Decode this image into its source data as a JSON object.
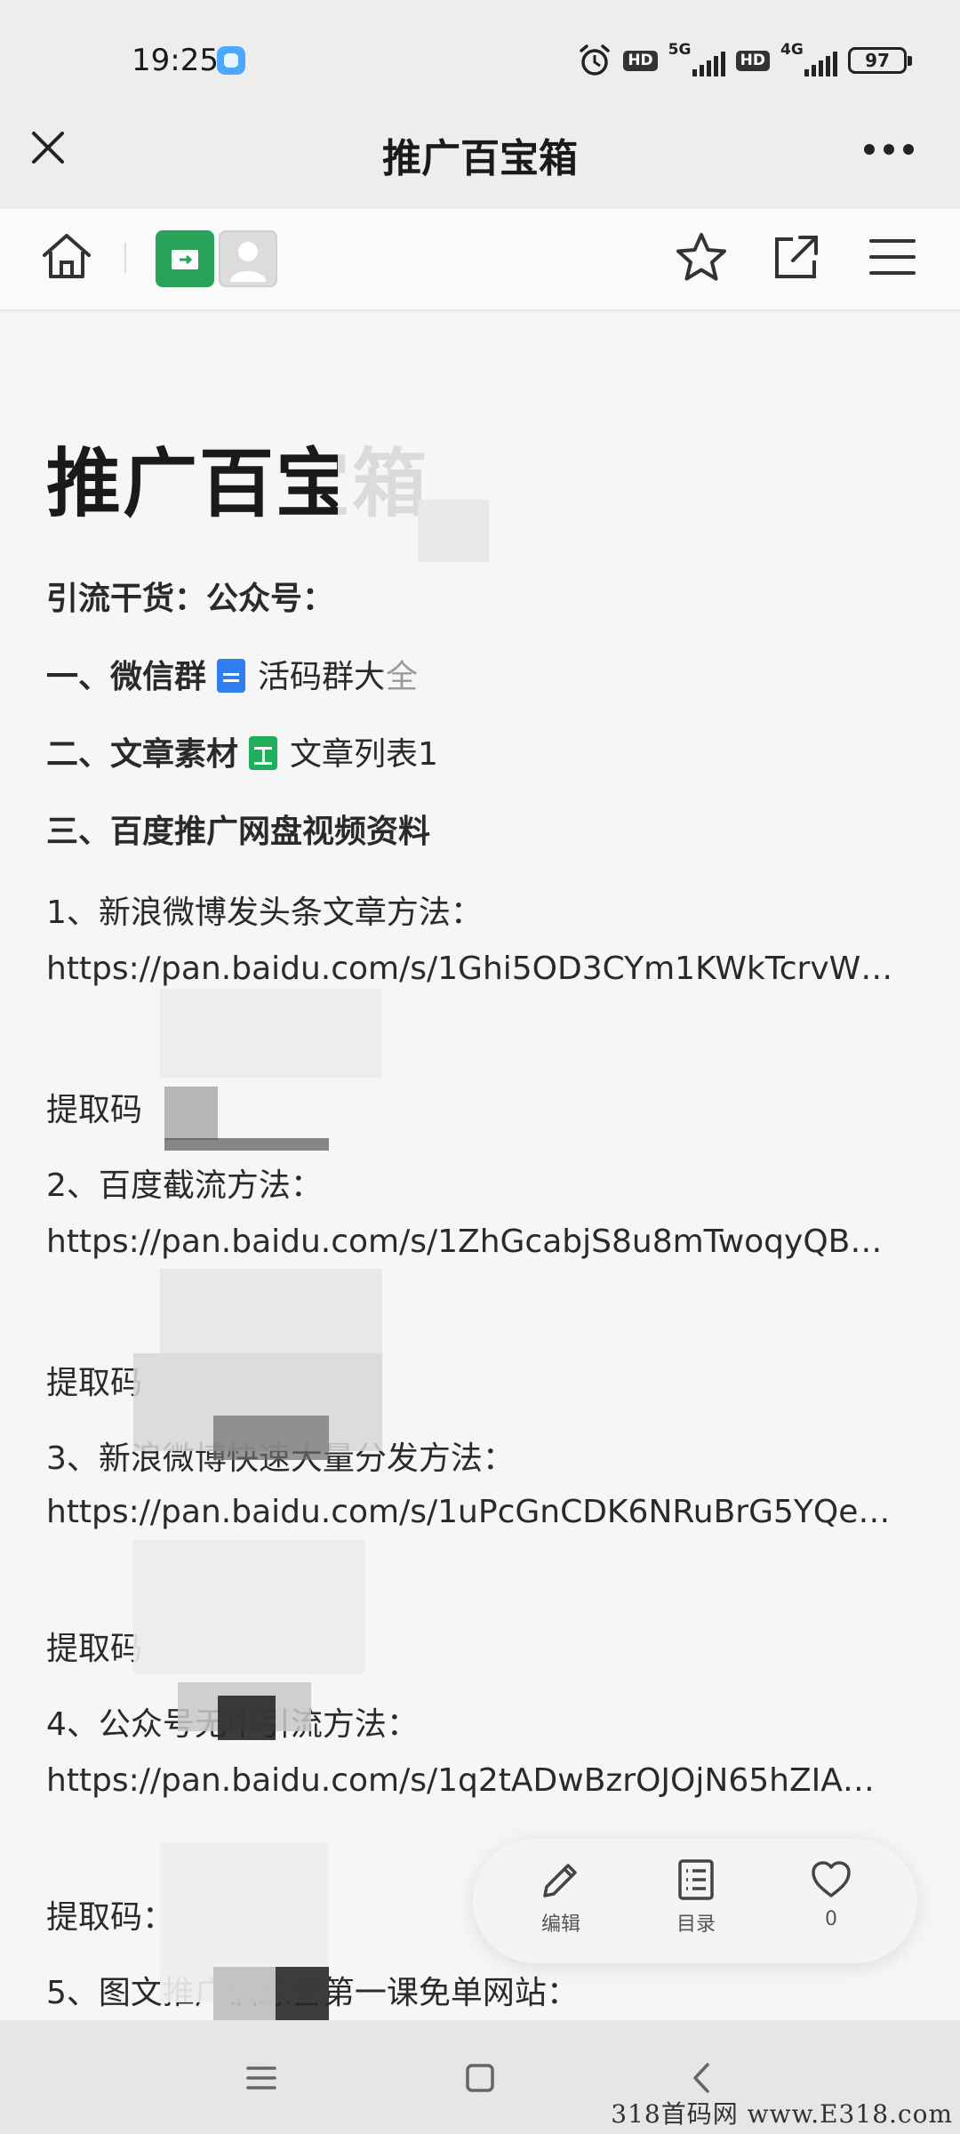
{
  "status_bar": {
    "time": "19:25",
    "hd_label": "HD",
    "net1": "5G",
    "net2": "4G",
    "battery": "97"
  },
  "title_bar": {
    "title": "推广百宝箱"
  },
  "document": {
    "title": "推广百宝箱",
    "lines": [
      {
        "text": "引流干货：公众号：",
        "bold": true
      },
      {
        "text": "一、微信群",
        "bold": true,
        "attachment_icon": "doc-blue-icon",
        "attachment_text": "活码群大全"
      },
      {
        "text": "二、文章素材",
        "bold": true,
        "attachment_icon": "sheet-green-icon",
        "attachment_text": "文章列表1"
      },
      {
        "text": "三、百度推广网盘视频资料",
        "bold": true
      },
      {
        "text": "1、新浪微博发头条文章方法："
      },
      {
        "text": "https://pan.baidu.com/s/1Ghi5OD3CYm1KWkTcrvW…"
      },
      {
        "text": "提取码"
      },
      {
        "text": "2、百度截流方法："
      },
      {
        "text": "https://pan.baidu.com/s/1ZhGcabjS8u8mTwoqyQB…"
      },
      {
        "text": "提取码"
      },
      {
        "text": "3、新浪微博快速大量分发方法："
      },
      {
        "text": "https://pan.baidu.com/s/1uPcGnCDK6NRuBrG5YQe…"
      },
      {
        "text": "提取码"
      },
      {
        "text": "4、公众号无中引流方法："
      },
      {
        "text": "https://pan.baidu.com/s/1q2tADwBzrOJOjN65hZIA…"
      },
      {
        "text": "提取码："
      },
      {
        "text": "5、图文推广训练营第一课免单网站："
      }
    ]
  },
  "fab": {
    "edit_label": "编辑",
    "toc_label": "目录",
    "like_count": "0"
  },
  "watermark": "318首码网 www.E318.com",
  "colors": {
    "folder_green": "#27a35a",
    "doc_blue": "#2f7ff0",
    "sheet_green": "#1fae5b"
  }
}
